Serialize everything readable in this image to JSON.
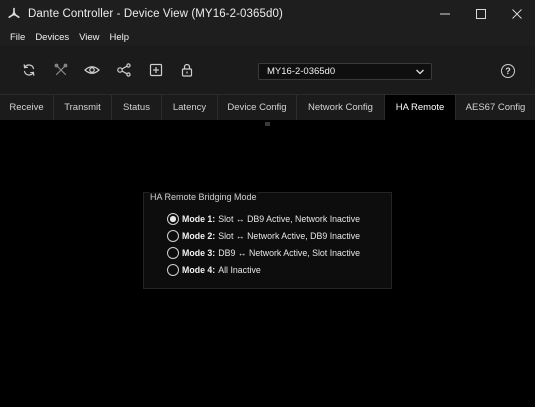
{
  "window": {
    "title": "Dante Controller - Device View (MY16-2-0365d0)",
    "controls": {
      "minimize": "—",
      "maximize": "☐",
      "close": "✕"
    }
  },
  "menu": [
    "File",
    "Devices",
    "View",
    "Help"
  ],
  "toolbar": {
    "icons": [
      "refresh-icon",
      "tools-icon",
      "eye-icon",
      "share-icon",
      "add-box-icon",
      "lock-icon"
    ],
    "device_select_value": "MY16-2-0365d0",
    "help_label": "?"
  },
  "tabs": [
    {
      "label": "Receive",
      "active": false
    },
    {
      "label": "Transmit",
      "active": false
    },
    {
      "label": "Status",
      "active": false
    },
    {
      "label": "Latency",
      "active": false
    },
    {
      "label": "Device Config",
      "active": false
    },
    {
      "label": "Network Config",
      "active": false
    },
    {
      "label": "HA Remote",
      "active": true
    },
    {
      "label": "AES67 Config",
      "active": false
    }
  ],
  "ha_remote": {
    "group_title": "HA Remote Bridging Mode",
    "modes": [
      {
        "name": "Mode 1:",
        "desc": "Slot ↔ DB9 Active, Network Inactive",
        "selected": true
      },
      {
        "name": "Mode 2:",
        "desc": "Slot ↔ Network Active, DB9 Inactive",
        "selected": false
      },
      {
        "name": "Mode 3:",
        "desc": "DB9 ↔ Network Active, Slot Inactive",
        "selected": false
      },
      {
        "name": "Mode 4:",
        "desc": "All Inactive",
        "selected": false
      }
    ]
  }
}
